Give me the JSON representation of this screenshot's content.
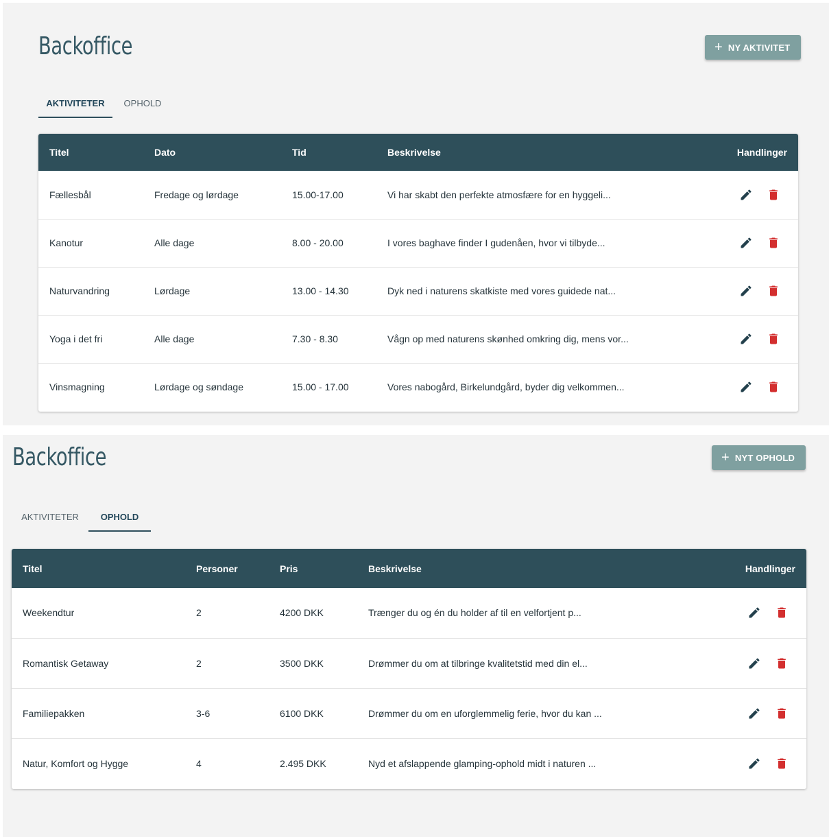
{
  "panel1": {
    "app_title": "Backoffice",
    "add_button": {
      "icon": "plus-icon",
      "label": "NY AKTIVITET"
    },
    "tabs": [
      {
        "label": "AKTIVITETER",
        "active": true
      },
      {
        "label": "OPHOLD",
        "active": false
      }
    ],
    "table": {
      "columns": [
        "Titel",
        "Dato",
        "Tid",
        "Beskrivelse",
        "Handlinger"
      ],
      "rows": [
        {
          "titel": "Fællesbål",
          "dato": "Fredage og lørdage",
          "tid": "15.00-17.00",
          "beskrivelse": "Vi har skabt den perfekte atmosfære for en hyggeli..."
        },
        {
          "titel": "Kanotur",
          "dato": "Alle dage",
          "tid": "8.00 - 20.00",
          "beskrivelse": "I vores baghave finder I gudenåen, hvor vi tilbyde..."
        },
        {
          "titel": "Naturvandring",
          "dato": "Lørdage",
          "tid": "13.00 - 14.30",
          "beskrivelse": "Dyk ned i naturens skatkiste med vores guidede nat..."
        },
        {
          "titel": "Yoga i det fri",
          "dato": "Alle dage",
          "tid": "7.30 - 8.30",
          "beskrivelse": "Vågn op med naturens skønhed omkring dig, mens vor..."
        },
        {
          "titel": "Vinsmagning",
          "dato": "Lørdage og søndage",
          "tid": "15.00 - 17.00",
          "beskrivelse": "Vores nabogård, Birkelundgård, byder dig velkommen..."
        }
      ]
    }
  },
  "panel2": {
    "app_title": "Backoffice",
    "add_button": {
      "icon": "plus-icon",
      "label": "NYT OPHOLD"
    },
    "tabs": [
      {
        "label": "AKTIVITETER",
        "active": false
      },
      {
        "label": "OPHOLD",
        "active": true
      }
    ],
    "table": {
      "columns": [
        "Titel",
        "Personer",
        "Pris",
        "Beskrivelse",
        "Handlinger"
      ],
      "rows": [
        {
          "titel": "Weekendtur",
          "personer": "2",
          "pris": "4200 DKK",
          "beskrivelse": "Trænger du og én du holder af til en velfortjent p..."
        },
        {
          "titel": "Romantisk Getaway",
          "personer": "2",
          "pris": "3500 DKK",
          "beskrivelse": "Drømmer du om at tilbringe kvalitetstid med din el..."
        },
        {
          "titel": "Familiepakken",
          "personer": "3-6",
          "pris": "6100 DKK",
          "beskrivelse": "Drømmer du om en uforglemmelig ferie, hvor du kan ..."
        },
        {
          "titel": "Natur, Komfort og Hygge",
          "personer": "4",
          "pris": "2.495 DKK",
          "beskrivelse": "Nyd et afslappende glamping-ophold midt i naturen ..."
        }
      ]
    }
  },
  "colors": {
    "header_bg": "#2e4f5a",
    "button_bg": "#7fa0a0",
    "title": "#355864",
    "edit_icon": "#24414d",
    "delete_icon": "#d32f2f"
  },
  "icons": {
    "edit": "pencil-icon",
    "delete": "trash-icon"
  }
}
